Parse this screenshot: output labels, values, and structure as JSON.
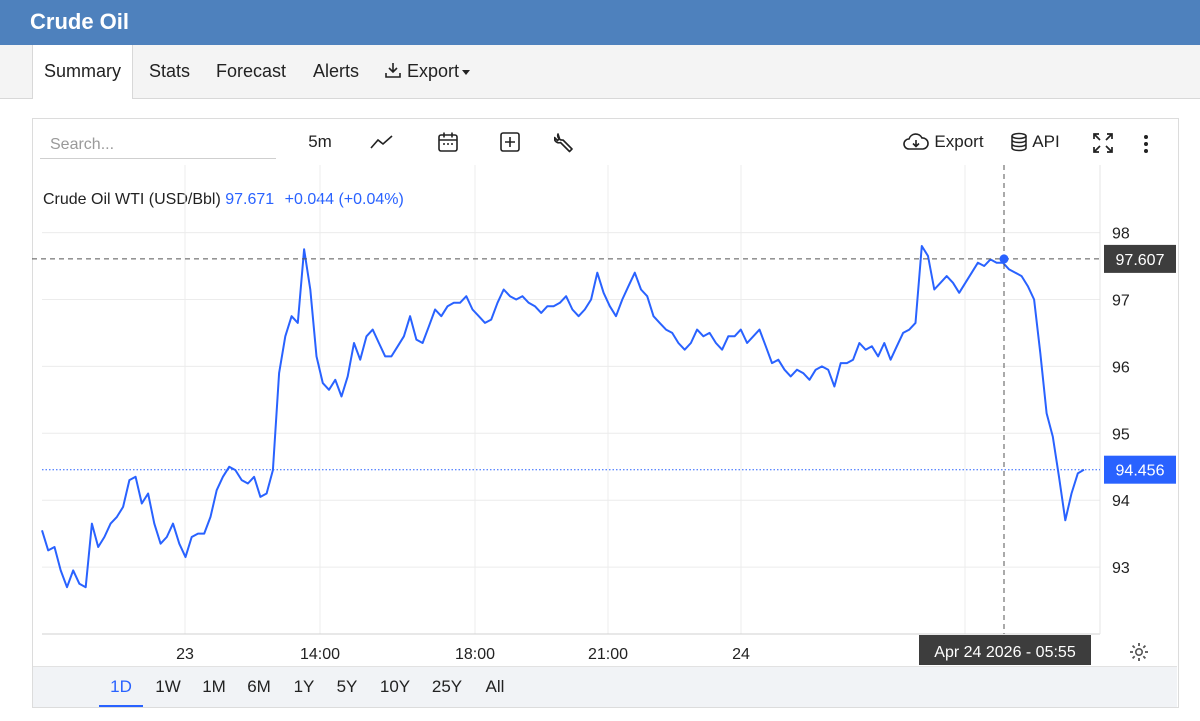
{
  "header": {
    "title": "Crude Oil"
  },
  "tabs": [
    {
      "label": "Summary",
      "active": true
    },
    {
      "label": "Stats"
    },
    {
      "label": "Forecast"
    },
    {
      "label": "Alerts"
    },
    {
      "label": "Export",
      "icon": "download-icon",
      "dropdown": true
    }
  ],
  "toolbar": {
    "search_placeholder": "Search...",
    "interval": "5m",
    "export_label": "Export",
    "api_label": "API",
    "icons": [
      "line-chart-icon",
      "calendar-icon",
      "plus-box-icon",
      "wrench-icon",
      "cloud-download-icon",
      "database-icon",
      "fullscreen-icon",
      "more-vertical-icon",
      "settings-icon"
    ]
  },
  "legend": {
    "symbol": "Crude Oil WTI (USD/Bbl)",
    "last": "97.671",
    "change": "+0.044 (+0.04%)"
  },
  "crosshair": {
    "price_label": "97.607",
    "time_label": "Apr 24 2026 - 05:55"
  },
  "current_price_label": "94.456",
  "periods": [
    {
      "label": "1D",
      "active": true
    },
    {
      "label": "1W"
    },
    {
      "label": "1M"
    },
    {
      "label": "6M"
    },
    {
      "label": "1Y"
    },
    {
      "label": "5Y"
    },
    {
      "label": "10Y"
    },
    {
      "label": "25Y"
    },
    {
      "label": "All"
    }
  ],
  "colors": {
    "header": "#4e81bd",
    "line": "#2962ff",
    "crosshair_label": "#3d3d3d"
  },
  "chart_data": {
    "type": "line",
    "title": "",
    "ylim": [
      92,
      99
    ],
    "y_ticks": [
      "93",
      "94",
      "95",
      "96",
      "97",
      "98"
    ],
    "x_tick_labels": [
      "23",
      "14:00",
      "18:00",
      "21:00",
      "24"
    ],
    "grid": true,
    "series": [
      {
        "name": "Crude Oil WTI (USD/Bbl)",
        "values": [
          93.55,
          93.25,
          93.3,
          92.95,
          92.7,
          92.95,
          92.75,
          92.7,
          93.65,
          93.3,
          93.45,
          93.65,
          93.75,
          93.9,
          94.3,
          94.35,
          93.95,
          94.1,
          93.65,
          93.35,
          93.45,
          93.65,
          93.35,
          93.15,
          93.45,
          93.5,
          93.5,
          93.75,
          94.15,
          94.35,
          94.5,
          94.45,
          94.3,
          94.25,
          94.35,
          94.05,
          94.1,
          94.45,
          95.9,
          96.45,
          96.75,
          96.65,
          97.75,
          97.15,
          96.15,
          95.75,
          95.65,
          95.8,
          95.55,
          95.85,
          96.35,
          96.1,
          96.45,
          96.55,
          96.35,
          96.15,
          96.15,
          96.3,
          96.45,
          96.75,
          96.4,
          96.35,
          96.6,
          96.85,
          96.75,
          96.9,
          96.95,
          96.95,
          97.05,
          96.85,
          96.75,
          96.65,
          96.7,
          96.95,
          97.15,
          97.05,
          97.0,
          97.05,
          96.95,
          96.9,
          96.8,
          96.9,
          96.9,
          96.95,
          97.05,
          96.85,
          96.75,
          96.85,
          97.0,
          97.4,
          97.1,
          96.9,
          96.75,
          97.0,
          97.2,
          97.4,
          97.15,
          97.05,
          96.75,
          96.65,
          96.55,
          96.5,
          96.35,
          96.25,
          96.35,
          96.55,
          96.45,
          96.5,
          96.35,
          96.25,
          96.45,
          96.45,
          96.55,
          96.35,
          96.45,
          96.55,
          96.3,
          96.05,
          96.1,
          95.95,
          95.85,
          95.95,
          95.9,
          95.8,
          95.95,
          96.0,
          95.95,
          95.7,
          96.05,
          96.05,
          96.1,
          96.35,
          96.25,
          96.3,
          96.15,
          96.35,
          96.1,
          96.3,
          96.5,
          96.55,
          96.65,
          97.8,
          97.65,
          97.15,
          97.25,
          97.35,
          97.25,
          97.1,
          97.25,
          97.4,
          97.55,
          97.5,
          97.6,
          97.55,
          97.55,
          97.45,
          97.4,
          97.35,
          97.2,
          97.0,
          96.2,
          95.3,
          94.95,
          94.35,
          93.7,
          94.1,
          94.4,
          94.456
        ]
      }
    ]
  }
}
